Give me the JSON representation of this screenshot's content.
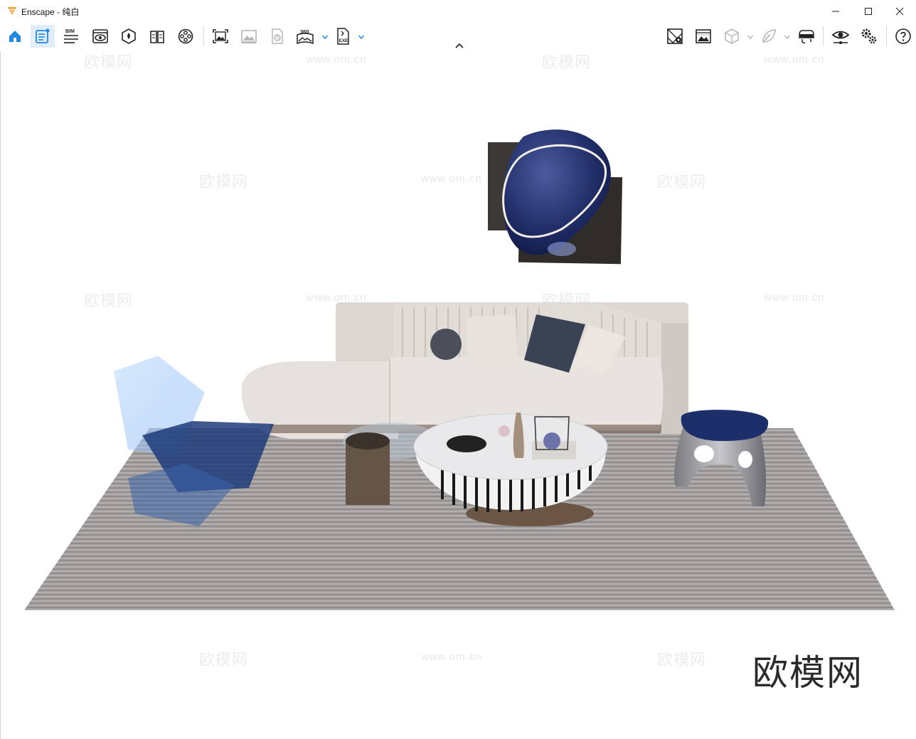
{
  "window": {
    "title": "Enscape - 纯白",
    "controls": {
      "minimize_icon": "minimize-icon",
      "maximize_icon": "maximize-icon",
      "close_icon": "close-icon"
    }
  },
  "toolbar": {
    "bim_label": "BIM",
    "panorama_label": "360",
    "exe_label": "EXE",
    "left_icons": [
      "home-icon",
      "assets-icon",
      "bim-icon",
      "views-icon",
      "atmosphere-icon",
      "material-editor-icon",
      "video-editor-icon",
      "screenshot-icon",
      "batch-render-icon",
      "file-export-icon",
      "panorama-icon",
      "exe-export-icon"
    ],
    "right_icons": [
      "site-context-icon",
      "atmosphere-image-icon",
      "cube-view-icon",
      "leaf-icon",
      "vr-headset-icon",
      "visual-settings-icon",
      "general-settings-icon",
      "help-icon"
    ],
    "active_color": "#1e88e5",
    "active_bg": "#e1eefa"
  },
  "viewport": {
    "watermark_logo": "欧模网",
    "watermark_url": "www.om.cn",
    "brand": "欧模网"
  }
}
